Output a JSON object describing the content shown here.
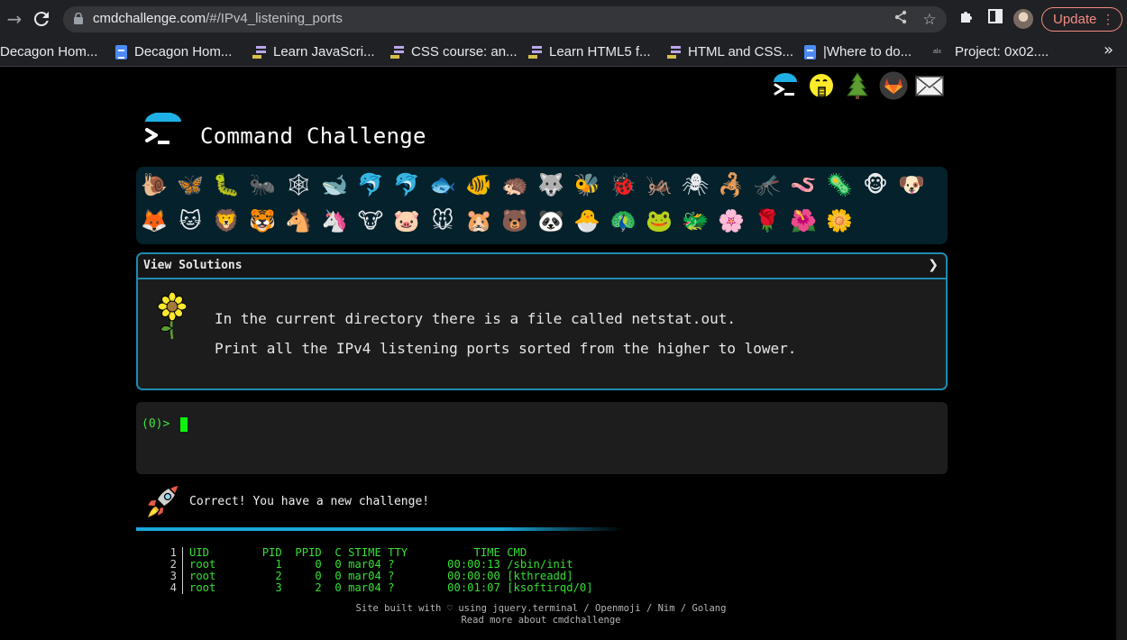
{
  "browser": {
    "url_host": "cmdchallenge.com",
    "url_path": "/#/IPv4_listening_ports",
    "update_label": "Update",
    "bookmarks": [
      {
        "label": "Decagon Hom...",
        "icon": "none"
      },
      {
        "label": "Decagon Hom...",
        "icon": "docs-icon"
      },
      {
        "label": "Learn JavaScri...",
        "icon": "freecodecamp-icon"
      },
      {
        "label": "CSS course: an...",
        "icon": "freecodecamp-icon"
      },
      {
        "label": "Learn HTML5 f...",
        "icon": "freecodecamp-icon"
      },
      {
        "label": "HTML and CSS...",
        "icon": "freecodecamp-icon"
      },
      {
        "label": "|Where to do...",
        "icon": "docs-icon"
      },
      {
        "label": "Project: 0x02....",
        "icon": "alx-icon"
      }
    ],
    "bookmarks_more": "»"
  },
  "header": {
    "title": "Command Challenge",
    "top_icons": [
      "terminal-icon",
      "face-with-hand-over-mouth-icon",
      "evergreen-tree-icon",
      "gitlab-icon",
      "envelope-icon"
    ]
  },
  "emoji_panel": {
    "row1": [
      "🐌",
      "🦋",
      "🐛",
      "🐜",
      "🕸",
      "🐋",
      "🐬",
      "🐬",
      "🐟",
      "🐠",
      "🦔",
      "🐺",
      "🐝",
      "🐞",
      "🦗",
      "🕷",
      "🦂",
      "🦟",
      "🪱",
      "🦠",
      "🐵",
      "🐶"
    ],
    "row2": [
      "🦊",
      "🐱",
      "🦁",
      "🐯",
      "🐴",
      "🦄",
      "🐮",
      "🐷",
      "🐭",
      "🐹",
      "🐻",
      "🐼",
      "🐣",
      "🦚",
      "🐸",
      "🐲",
      "🌸",
      "🌹",
      "🌺",
      "🌼"
    ]
  },
  "solutions": {
    "title": "View Solutions",
    "chevron": "❯",
    "task_line_1": "In the current directory there is a file called netstat.out.",
    "task_line_2": "Print all the IPv4 listening ports sorted from the higher to lower."
  },
  "terminal": {
    "prompt": "(0)> "
  },
  "result": {
    "message": "Correct! You have a new challenge!"
  },
  "output": {
    "lines": [
      {
        "n": "1",
        "text": "UID        PID  PPID  C STIME TTY          TIME CMD"
      },
      {
        "n": "2",
        "text": "root         1     0  0 mar04 ?        00:00:13 /sbin/init"
      },
      {
        "n": "3",
        "text": "root         2     0  0 mar04 ?        00:00:00 [kthreadd]"
      },
      {
        "n": "4",
        "text": "root         3     2  0 mar04 ?        00:01:07 [ksoftirqd/0]"
      }
    ]
  },
  "footer": {
    "line1": "Site built with ♡ using jquery.terminal / Openmoji / Nim / Golang",
    "line2": "Read more about cmdchallenge"
  },
  "colors": {
    "accent": "#1f8bb0",
    "terminal_green": "#34e034",
    "panel_bg": "#05212b"
  }
}
